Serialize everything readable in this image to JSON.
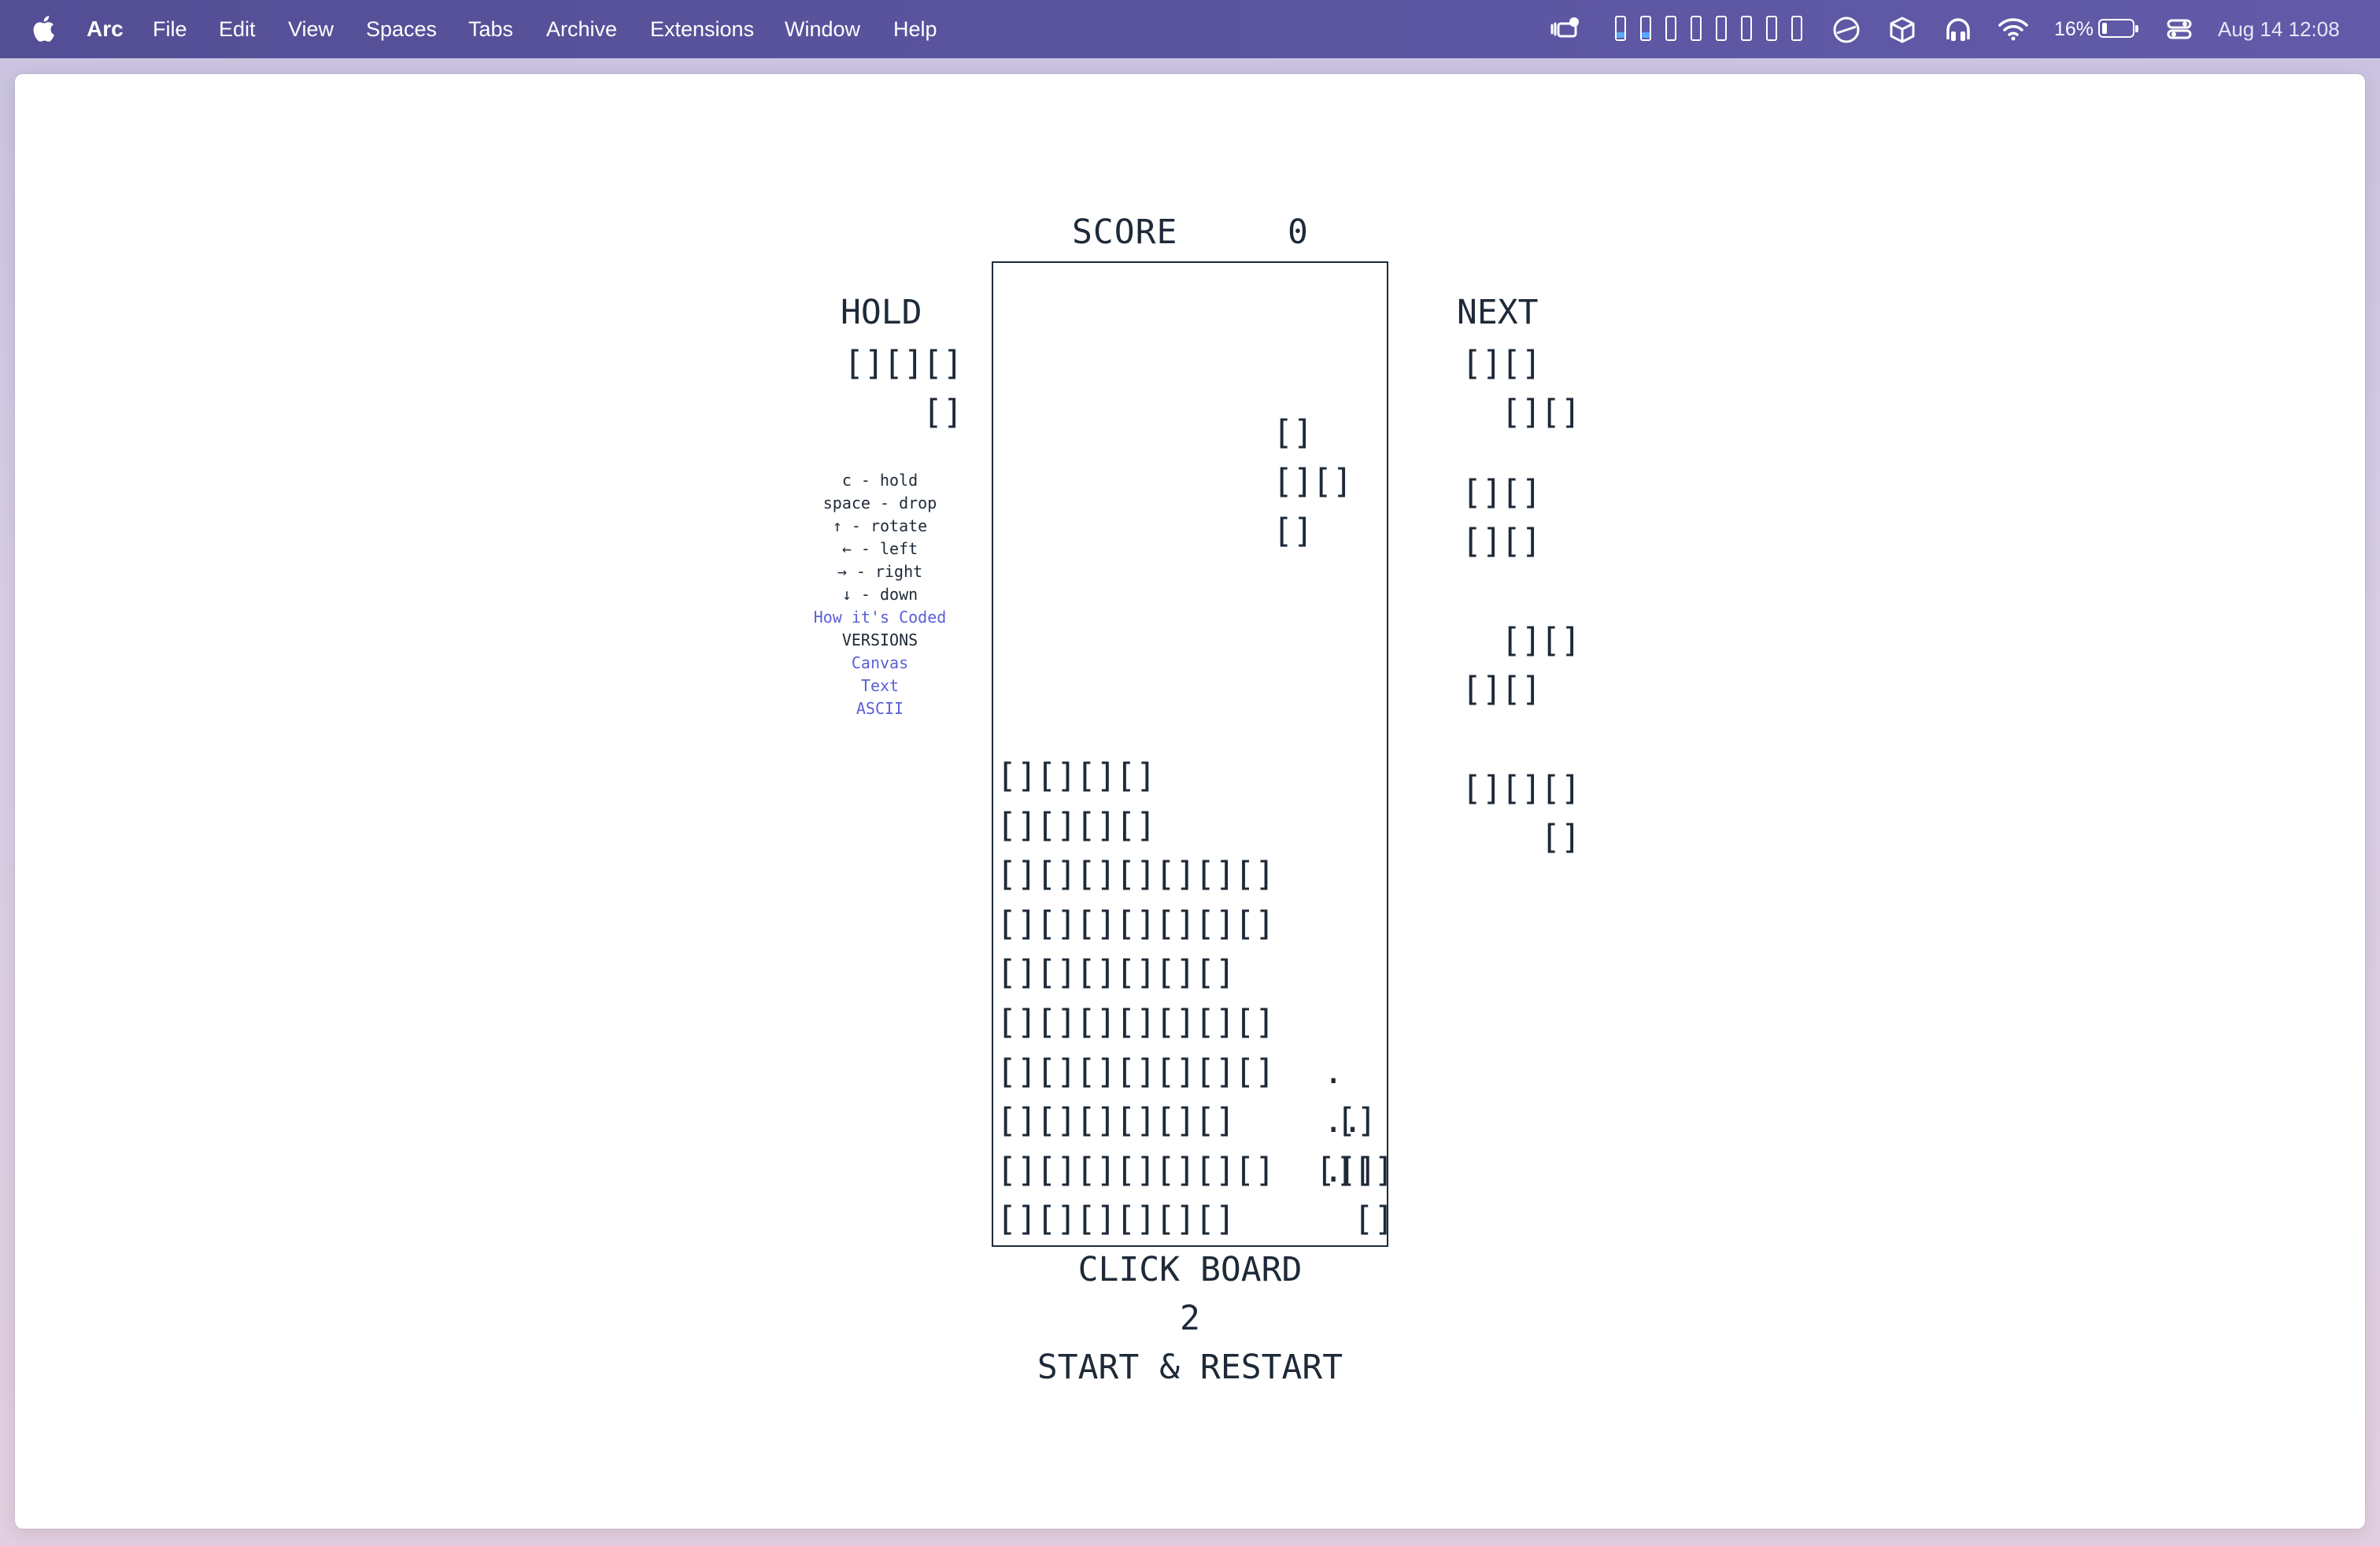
{
  "menubar": {
    "app_name": "Arc",
    "menus": [
      "File",
      "Edit",
      "View",
      "Spaces",
      "Tabs",
      "Archive",
      "Extensions",
      "Window",
      "Help"
    ],
    "battery_percent": "16%",
    "datetime": "Aug 14  12:08",
    "status_icons": [
      "stage-manager-icon",
      "spaces-indicator",
      "safari-icon",
      "box-icon",
      "headphones-icon",
      "wifi-icon",
      "battery-icon",
      "control-center-icon"
    ]
  },
  "game": {
    "score_label": "SCORE",
    "score_value": "0",
    "hold_label": "HOLD",
    "next_label": "NEXT",
    "controls": [
      "c - hold",
      "space - drop",
      "↑ - rotate",
      "← - left",
      "→ - right",
      "↓ - down"
    ],
    "how_coded_link": "How it's Coded",
    "versions_label": "VERSIONS",
    "versions": [
      "Canvas",
      "Text",
      "ASCII"
    ],
    "bottom": {
      "line1": "CLICK BOARD",
      "line2": "2",
      "line3": "START & RESTART"
    },
    "block_glyph": "[]",
    "ghost_glyph": "."
  }
}
